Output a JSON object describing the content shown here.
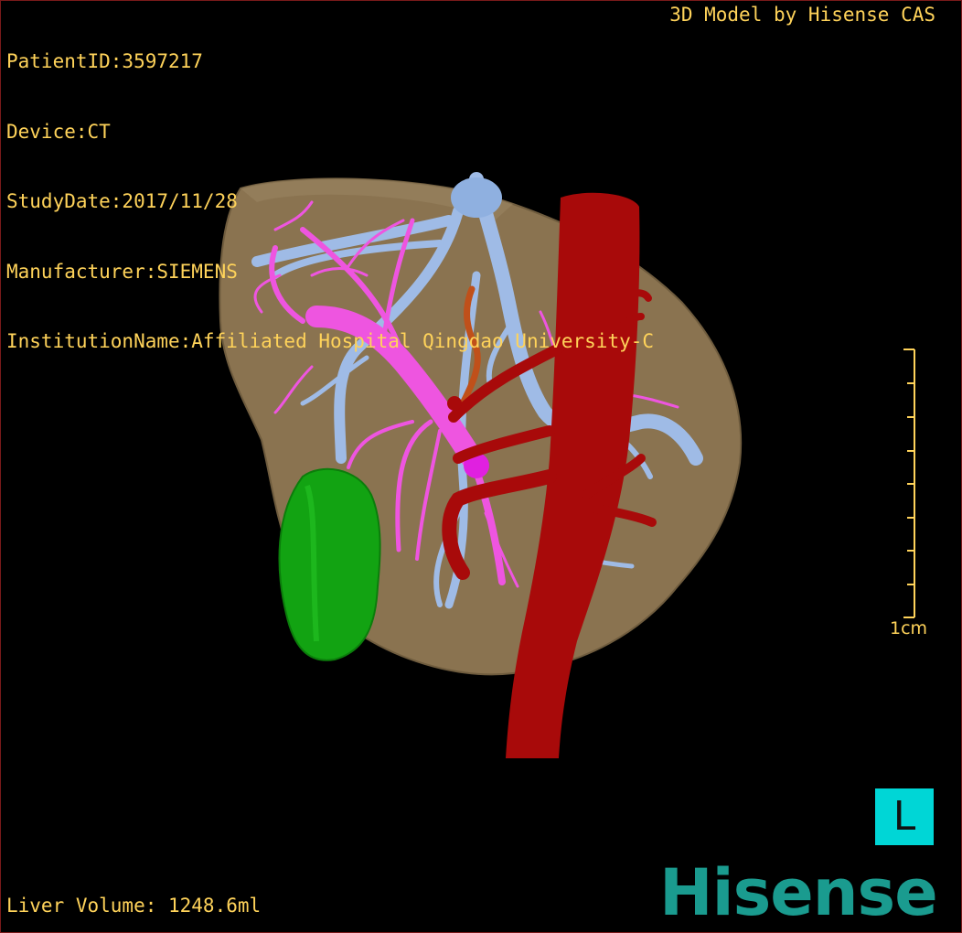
{
  "patient_info": {
    "patient_id": "PatientID:3597217",
    "device": "Device:CT",
    "study_date": "StudyDate:2017/11/28",
    "manufacturer": "Manufacturer:SIEMENS",
    "institution": "InstitutionName:Affiliated Hospital Qingdao University-C"
  },
  "model_credit": "3D Model by Hisense CAS",
  "liver_volume": "Liver Volume: 1248.6ml",
  "scale_bar": {
    "label": "1cm"
  },
  "orientation": {
    "label": "L",
    "color": "#00d6d6"
  },
  "logo": {
    "text": "Hisense",
    "color": "#1a9b8f"
  },
  "colors": {
    "text": "#ffd35a",
    "liver": "#8a7350",
    "hepatic_vein": "#9fbbe6",
    "portal_vein": "#ee55e0",
    "artery_ivc": "#a80a0a",
    "gallbladder": "#12a312"
  }
}
